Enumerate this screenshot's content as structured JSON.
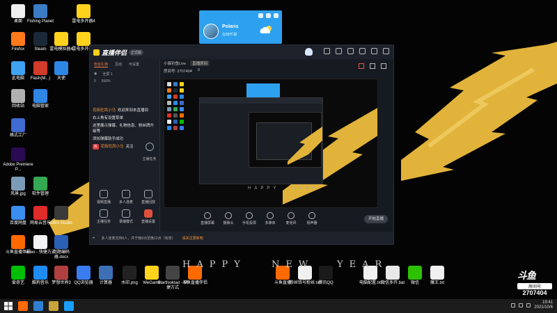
{
  "desktop": {
    "icons_left": [
      {
        "label": "桌面",
        "color": "#f0f0f0"
      },
      {
        "label": "Fishing Planet",
        "color": "#3b7cc4"
      },
      {
        "label": "雷电多开器4",
        "color": "#ffd21e"
      },
      {
        "label": "Firefox",
        "color": "#ff7a1a"
      },
      {
        "label": "Steam",
        "color": "#1b2838"
      },
      {
        "label": "雷电模拟器4",
        "color": "#ffd21e"
      },
      {
        "label": "雷电多开器4",
        "color": "#ffd21e"
      },
      {
        "label": "此电脑",
        "color": "#3ea3f2"
      },
      {
        "label": "Flash(M...)",
        "color": "#d23b2a"
      },
      {
        "label": "天使",
        "color": "#2f87e5"
      },
      {
        "label": "回收站",
        "color": "#b0b0b0"
      },
      {
        "label": "电脑管家",
        "color": "#2f87e5"
      },
      {
        "label": "格式工厂",
        "color": "#3f6ad1"
      },
      {
        "label": "Adobe Premiere P...",
        "color": "#2a0a52"
      },
      {
        "label": "风景.jpg",
        "color": "#7a9ab8"
      },
      {
        "label": "软件管理",
        "color": "#34a853"
      },
      {
        "label": "百度网盘",
        "color": "#3a8ef0"
      },
      {
        "label": "网易云音乐",
        "color": "#e02b2b"
      },
      {
        "label": "OBS Studio",
        "color": "#3a3a3a"
      },
      {
        "label": "斗鱼直播伴侣",
        "color": "#ff6a00"
      },
      {
        "label": "video - 快捷方式",
        "color": "#f4f4f4"
      },
      {
        "label": "问题编码器.docx",
        "color": "#2b5fb8"
      },
      {
        "label": "爱奇艺",
        "color": "#00be06"
      },
      {
        "label": "酷狗音乐",
        "color": "#1e8cf0"
      },
      {
        "label": "梦想世界3",
        "color": "#b04040"
      },
      {
        "label": "QQ浏览器",
        "color": "#3a7cf0"
      },
      {
        "label": "计算器",
        "color": "#3d6fb5"
      }
    ],
    "icons_bottom": [
      {
        "label": "水印.png",
        "color": "#222222"
      },
      {
        "label": "WeGame",
        "color": "#ffd21e"
      },
      {
        "label": "StartIsoktao - 快捷方式",
        "color": "#444444"
      },
      {
        "label": "斗鱼直播伴侣",
        "color": "#ff6a00"
      },
      {
        "label": "斗鱼直播",
        "color": "#ff6a00"
      },
      {
        "label": "粉丝铁号粉丝.txt",
        "color": "#f0f0f0"
      },
      {
        "label": "腾讯QQ",
        "color": "#1a1a1a"
      },
      {
        "label": "电脑配置.txt",
        "color": "#f0f0f0"
      },
      {
        "label": "微信多开.bat",
        "color": "#e8e8e8"
      },
      {
        "label": "微信",
        "color": "#2dc100"
      },
      {
        "label": "魔王.txt",
        "color": "#f0f0f0"
      }
    ],
    "happy_new_year": [
      "HAPPY",
      "NEW",
      "YEAR"
    ]
  },
  "qq_card": {
    "name": "Polaris",
    "status": "在线/忙碌"
  },
  "app": {
    "title": "直播伴侣",
    "version_badge": "正式版",
    "left_tabs": [
      "粉丝礼物",
      "互动",
      "可设置"
    ],
    "audience_label": "全屏 1",
    "stats": [
      "0",
      "550%"
    ],
    "chat": [
      {
        "tag": "",
        "text": "欢迎来到本直播间",
        "highlight": "花街狂风小马"
      },
      {
        "tag": "",
        "text": "右上角有设置菜单",
        "highlight": ""
      },
      {
        "tag": "",
        "text": "这里展示弹幕、礼物信息、粉丝牌升级等",
        "highlight": ""
      },
      {
        "tag": "",
        "text": "添加弹幕助手成功",
        "highlight": ""
      },
      {
        "tag": "热",
        "text": "关注",
        "highlight": "花街狂风小马"
      }
    ],
    "side_label": "主播任务",
    "tools": [
      "视频直播",
      "多人连麦",
      "直播回放",
      "主播任务",
      "录播模式",
      "直播设置"
    ],
    "preview": {
      "room_title": "小驿钓鱼Live",
      "category": "直播房间",
      "room_id": "房间号: 2707404",
      "viewers": "0"
    },
    "bottom_buttons": [
      "直播屏幕",
      "摄像头",
      "手机投屏",
      "多媒体",
      "麦克风",
      "扬声器"
    ],
    "start_button": "开始直播",
    "status_notice": "多人连麦支持6人，并于晚8点至晚12点（有效）",
    "status_link": "请关注更新吧"
  },
  "watermark": {
    "brand": "斗鱼",
    "label": "房间号",
    "room": "2707404"
  },
  "taskbar": {
    "time": "19:41",
    "date": "2021/10/6"
  }
}
